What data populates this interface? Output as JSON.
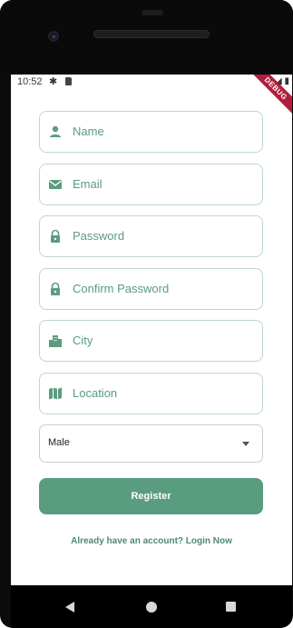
{
  "status": {
    "time": "10:52",
    "icons": [
      "gear-icon",
      "sd-card-icon",
      "wifi-icon",
      "signal-icon",
      "battery-icon"
    ]
  },
  "debug_banner": "DEBUG",
  "form": {
    "fields": [
      {
        "label": "Name",
        "icon": "person-icon"
      },
      {
        "label": "Email",
        "icon": "email-icon"
      },
      {
        "label": "Password",
        "icon": "lock-icon"
      },
      {
        "label": "Confirm Password",
        "icon": "lock-icon"
      },
      {
        "label": "City",
        "icon": "city-icon"
      },
      {
        "label": "Location",
        "icon": "map-icon"
      }
    ],
    "gender_value": "Male",
    "register_label": "Register",
    "login_prompt": "Already have an account? Login Now"
  },
  "theme": {
    "accent": "#5a9c80",
    "field_border": "#bcd8cb"
  }
}
